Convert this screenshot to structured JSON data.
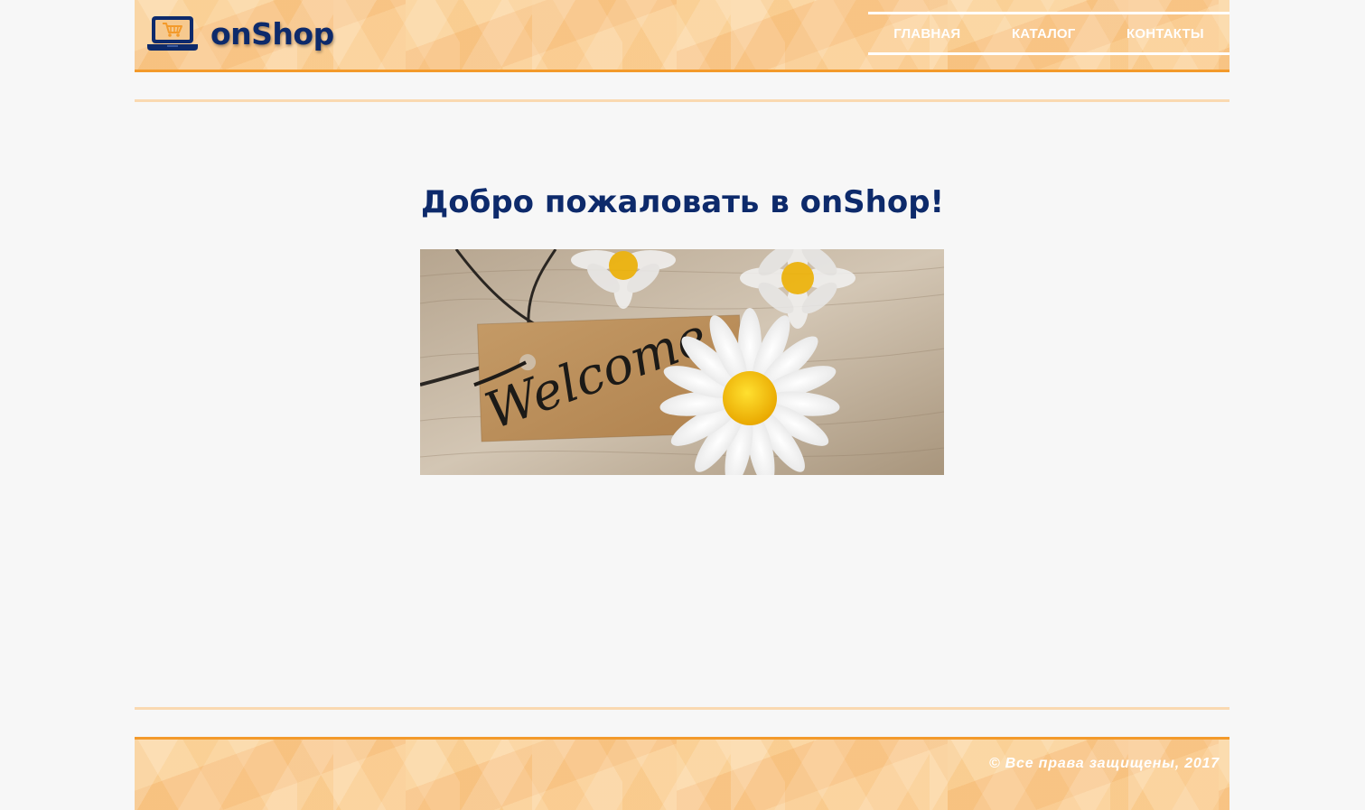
{
  "header": {
    "logo_text": "onShop",
    "logo_icon": "laptop-cart-icon",
    "nav": [
      {
        "label": "ГЛАВНАЯ"
      },
      {
        "label": "КАТАЛОГ"
      },
      {
        "label": "КОНТАКТЫ"
      }
    ]
  },
  "main": {
    "title": "Добро пожаловать в onShop!",
    "hero": {
      "tag_text": "Welcome"
    }
  },
  "footer": {
    "copyright": "© Все права защищены, 2017"
  },
  "colors": {
    "brand_blue": "#0d2a6b",
    "accent_orange": "#f39a2b",
    "header_bg": "#f9cf9b",
    "page_bg": "#f7f7f7"
  }
}
